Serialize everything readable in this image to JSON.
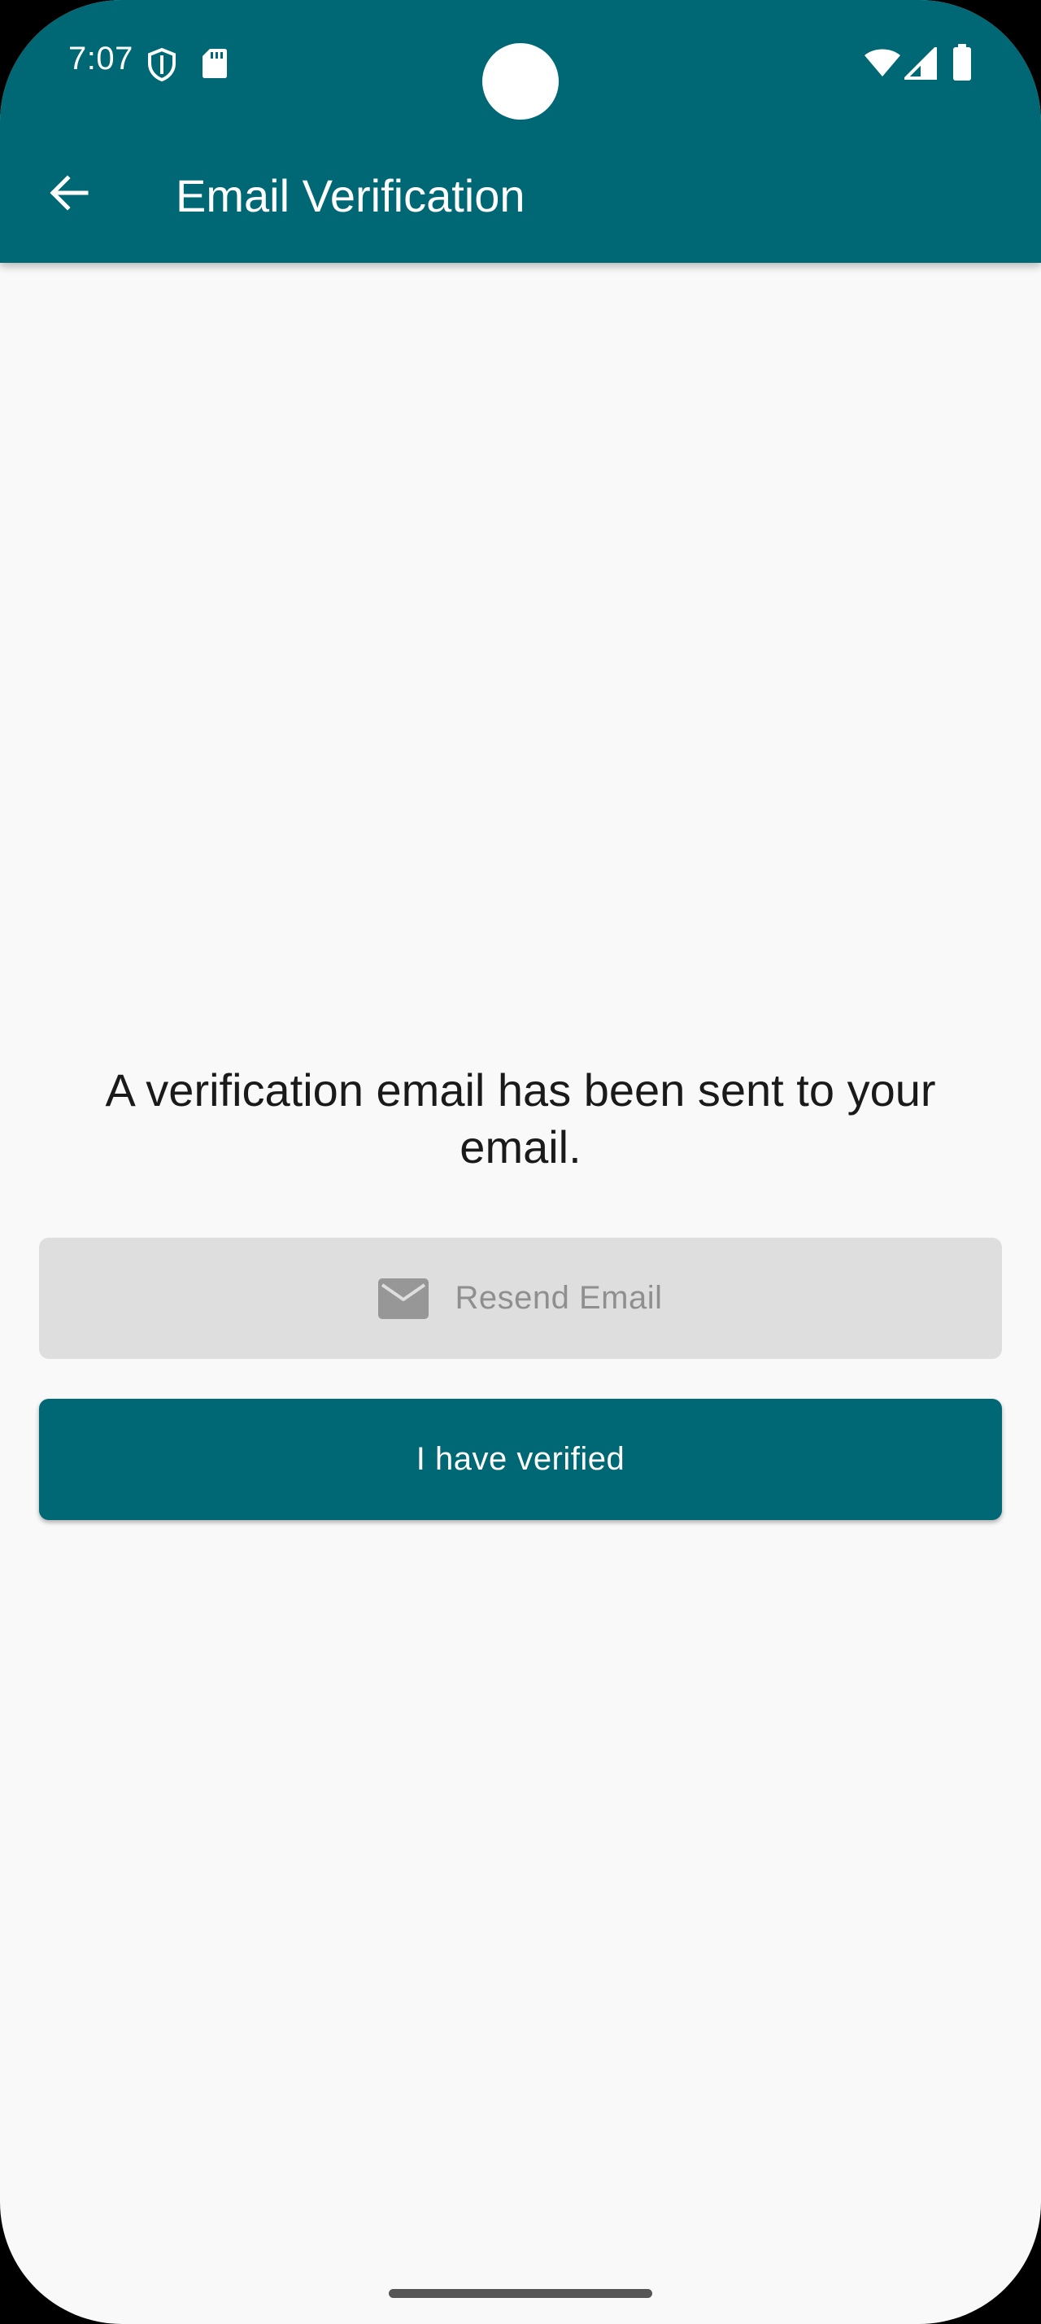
{
  "status_bar": {
    "time": "7:07",
    "icons": [
      "shield-icon",
      "sd-card-icon",
      "wifi-icon",
      "signal-icon",
      "battery-icon"
    ]
  },
  "app_bar": {
    "title": "Email Verification",
    "back_icon": "arrow-back-icon",
    "background_color": "#006874"
  },
  "main": {
    "message": "A verification email has been sent to your email.",
    "resend_button": {
      "label": "Resend Email",
      "icon": "mail-icon",
      "state": "disabled"
    },
    "verified_button": {
      "label": "I have verified"
    }
  }
}
